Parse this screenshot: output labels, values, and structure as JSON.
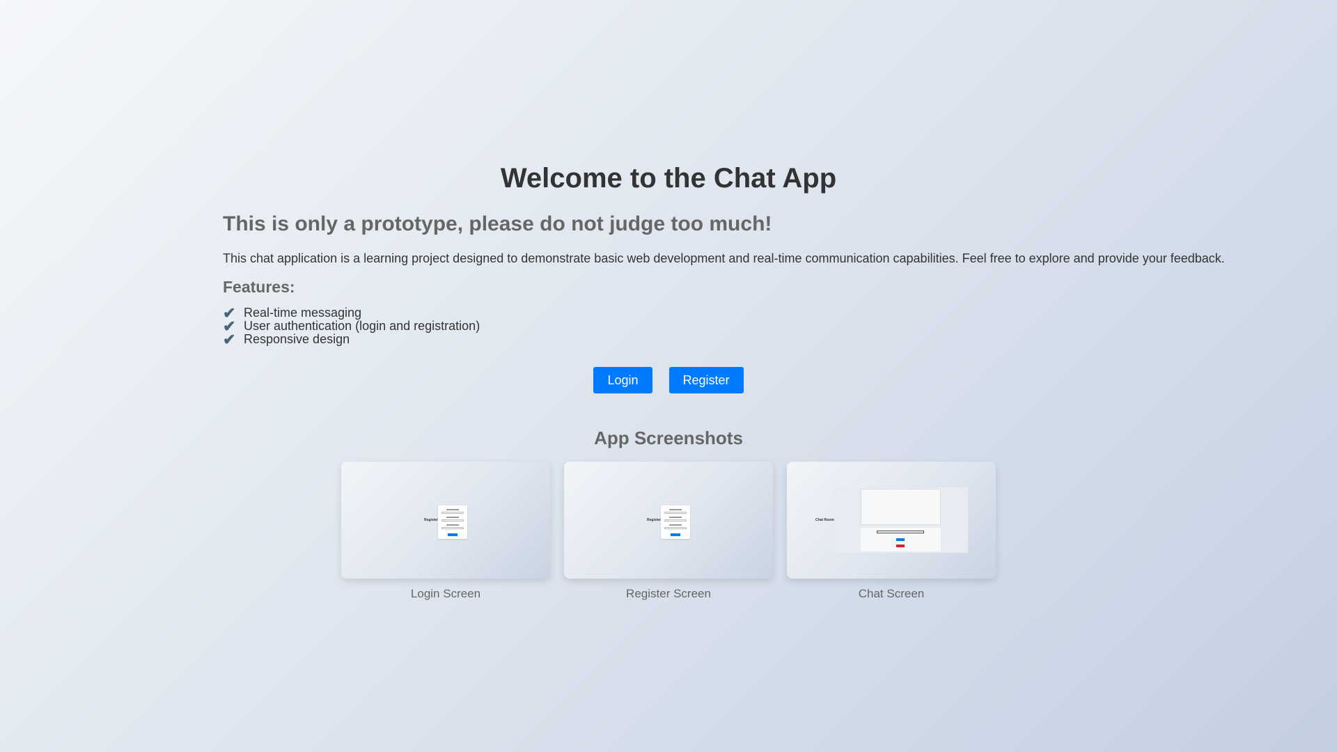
{
  "page": {
    "title": "Welcome to the Chat App",
    "subtitle": "This is only a prototype, please do not judge too much!",
    "description": "This chat application is a learning project designed to demonstrate basic web development and real-time communication capabilities. Feel free to explore and provide your feedback.",
    "features_heading": "Features:",
    "features": [
      {
        "icon": "check-icon",
        "glyph": "✔",
        "label": "Real-time messaging"
      },
      {
        "icon": "check-icon",
        "glyph": "✔",
        "label": "User authentication (login and registration)"
      },
      {
        "icon": "check-icon",
        "glyph": "✔",
        "label": "Responsive design"
      }
    ]
  },
  "buttons": {
    "login_label": "Login",
    "register_label": "Register"
  },
  "screenshots": {
    "heading": "App Screenshots",
    "items": [
      {
        "caption": "Login Screen",
        "mini_title": "Register"
      },
      {
        "caption": "Register Screen",
        "mini_title": "Register"
      },
      {
        "caption": "Chat Screen",
        "mini_title": "Chat Room"
      }
    ]
  },
  "colors": {
    "accent": "#007bff",
    "heading": "#333333",
    "muted": "#666666",
    "logout": "#e02020"
  }
}
